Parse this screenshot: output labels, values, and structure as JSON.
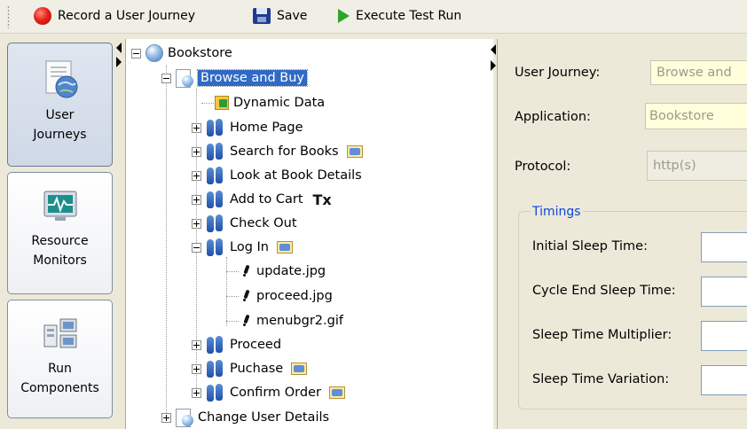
{
  "toolbar": {
    "record_label": "Record a User Journey",
    "save_label": "Save",
    "execute_label": "Execute Test Run",
    "colors": {
      "record": "#e8231a",
      "execute": "#2fa42a",
      "save": "#1f3a93"
    }
  },
  "nav": {
    "user_journeys": [
      "User",
      "Journeys"
    ],
    "resource_monitors": [
      "Resource",
      "Monitors"
    ],
    "run_components": [
      "Run",
      "Components"
    ],
    "active": "User Journeys"
  },
  "tree": {
    "root": "Bookstore",
    "journey": "Browse and Buy",
    "dynamic_data": "Dynamic Data",
    "pages": [
      "Home Page",
      "Search for Books",
      "Look at Book Details",
      "Add to Cart",
      "Check Out",
      "Log In"
    ],
    "tx_badge": "Tx",
    "resources": [
      "update.jpg",
      "proceed.jpg",
      "menubgr2.gif"
    ],
    "pages_after": [
      "Proceed",
      "Puchase",
      "Confirm Order"
    ],
    "next_journey": "Change User Details",
    "selection_color": "#316ac5"
  },
  "details": {
    "user_journey_label": "User Journey:",
    "user_journey_value": "Browse and",
    "application_label": "Application:",
    "application_value": "Bookstore",
    "protocol_label": "Protocol:",
    "protocol_value": "http(s)",
    "timings_title": "Timings",
    "initial_sleep_label": "Initial Sleep Time:",
    "cycle_end_sleep_label": "Cycle End Sleep Time:",
    "sleep_multiplier_label": "Sleep Time Multiplier:",
    "sleep_variation_label": "Sleep Time Variation:"
  }
}
